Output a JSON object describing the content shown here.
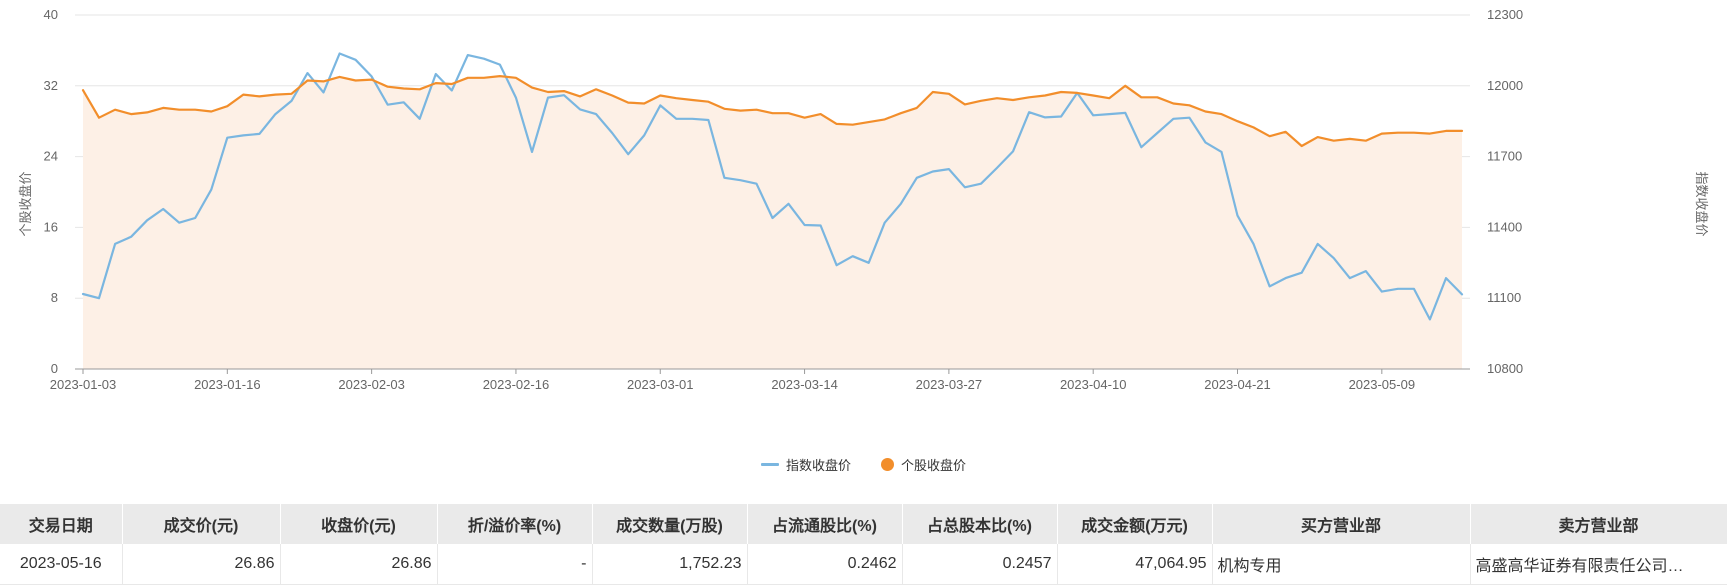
{
  "chart_data": {
    "type": "line",
    "title": "",
    "y_left": {
      "label": "个股收盘价",
      "min": 0,
      "max": 40,
      "ticks": [
        0,
        8,
        16,
        24,
        32,
        40
      ]
    },
    "y_right": {
      "label": "指数收盘价",
      "min": 10800,
      "max": 12300,
      "ticks": [
        10800,
        11100,
        11400,
        11700,
        12000,
        12300
      ]
    },
    "x_ticks": [
      {
        "label": "2023-01-03",
        "index": 0
      },
      {
        "label": "2023-01-16",
        "index": 9
      },
      {
        "label": "2023-02-03",
        "index": 18
      },
      {
        "label": "2023-02-16",
        "index": 27
      },
      {
        "label": "2023-03-01",
        "index": 36
      },
      {
        "label": "2023-03-14",
        "index": 45
      },
      {
        "label": "2023-03-27",
        "index": 54
      },
      {
        "label": "2023-04-10",
        "index": 63
      },
      {
        "label": "2023-04-21",
        "index": 72
      },
      {
        "label": "2023-05-09",
        "index": 81
      }
    ],
    "grid": true,
    "legend_position": "bottom-center",
    "series": [
      {
        "name": "指数收盘价",
        "axis": "right",
        "color": "#7ab6e0",
        "values": [
          11118,
          11100,
          11330,
          11360,
          11430,
          11478,
          11420,
          11440,
          11560,
          11780,
          11790,
          11796,
          11880,
          11936,
          12054,
          11972,
          12137,
          12110,
          12040,
          11920,
          11930,
          11860,
          12050,
          11980,
          12130,
          12115,
          12090,
          11950,
          11720,
          11950,
          11960,
          11900,
          11880,
          11800,
          11710,
          11790,
          11917,
          11860,
          11860,
          11855,
          11610,
          11600,
          11585,
          11440,
          11500,
          11410,
          11408,
          11240,
          11278,
          11250,
          11420,
          11500,
          11610,
          11637,
          11647,
          11570,
          11585,
          11652,
          11722,
          11888,
          11866,
          11870,
          11970,
          11875,
          11880,
          11885,
          11740,
          11800,
          11860,
          11865,
          11760,
          11720,
          11450,
          11330,
          11150,
          11185,
          11208,
          11330,
          11270,
          11185,
          11215,
          11128,
          11140,
          11140,
          11010,
          11185,
          11116
        ]
      },
      {
        "name": "个股收盘价",
        "axis": "left",
        "color": "#f28e2b",
        "fill": "#fdf0e6",
        "values": [
          31.5,
          28.4,
          29.3,
          28.8,
          29.0,
          29.5,
          29.3,
          29.3,
          29.1,
          29.7,
          31.0,
          30.8,
          31.0,
          31.1,
          32.6,
          32.5,
          33.0,
          32.6,
          32.7,
          31.9,
          31.7,
          31.6,
          32.3,
          32.2,
          32.9,
          32.9,
          33.1,
          32.9,
          31.8,
          31.3,
          31.4,
          30.8,
          31.6,
          30.9,
          30.1,
          30.0,
          30.9,
          30.6,
          30.4,
          30.2,
          29.4,
          29.2,
          29.3,
          28.9,
          28.9,
          28.4,
          28.8,
          27.7,
          27.6,
          27.9,
          28.2,
          28.9,
          29.5,
          31.3,
          31.1,
          29.9,
          30.3,
          30.6,
          30.4,
          30.7,
          30.9,
          31.3,
          31.2,
          30.9,
          30.6,
          32.0,
          30.7,
          30.7,
          30.0,
          29.8,
          29.1,
          28.8,
          28.0,
          27.3,
          26.3,
          26.8,
          25.2,
          26.2,
          25.8,
          26.0,
          25.8,
          26.6,
          26.7,
          26.7,
          26.6,
          26.9,
          26.9
        ]
      }
    ]
  },
  "legend": {
    "index_label": "指数收盘价",
    "stock_label": "个股收盘价"
  },
  "table": {
    "headers": [
      "交易日期",
      "成交价(元)",
      "收盘价(元)",
      "折/溢价率(%)",
      "成交数量(万股)",
      "占流通股比(%)",
      "占总股本比(%)",
      "成交金额(万元)",
      "买方营业部",
      "卖方营业部"
    ],
    "rows": [
      [
        "2023-05-16",
        "26.86",
        "26.86",
        "-",
        "1,752.23",
        "0.2462",
        "0.2457",
        "47,064.95",
        "机构专用",
        "高盛高华证券有限责任公司…"
      ]
    ]
  }
}
